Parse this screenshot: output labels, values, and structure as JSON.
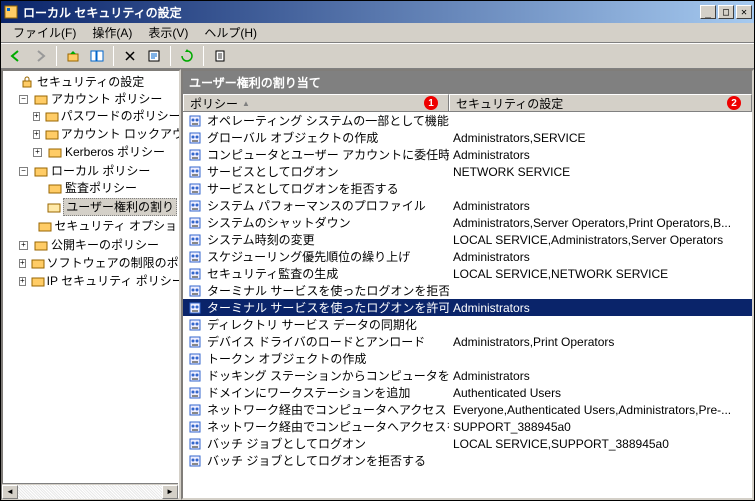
{
  "window": {
    "title": "ローカル セキュリティの設定"
  },
  "menu": {
    "file": "ファイル(F)",
    "action": "操作(A)",
    "view": "表示(V)",
    "help": "ヘルプ(H)"
  },
  "tree": {
    "root": "セキュリティの設定",
    "account": "アカウント ポリシー",
    "password": "パスワードのポリシー",
    "lockout": "アカウント ロックアウト",
    "kerberos": "Kerberos ポリシー",
    "local": "ローカル ポリシー",
    "audit": "監査ポリシー",
    "rights": "ユーザー権利の割り",
    "options": "セキュリティ オプショ",
    "publickey": "公開キーのポリシー",
    "software": "ソフトウェアの制限のポリシ",
    "ipsec": "IP セキュリティ ポリシー ("
  },
  "panel": {
    "title": "ユーザー権利の割り当て",
    "col1": "ポリシー",
    "col2": "セキュリティの設定",
    "badge1": "1",
    "badge2": "2"
  },
  "rows": [
    {
      "policy": "オペレーティング システムの一部として機能",
      "value": ""
    },
    {
      "policy": "グローバル オブジェクトの作成",
      "value": "Administrators,SERVICE"
    },
    {
      "policy": "コンピュータとユーザー アカウントに委任時の信頼を...",
      "value": "Administrators"
    },
    {
      "policy": "サービスとしてログオン",
      "value": "NETWORK SERVICE"
    },
    {
      "policy": "サービスとしてログオンを拒否する",
      "value": ""
    },
    {
      "policy": "システム パフォーマンスのプロファイル",
      "value": "Administrators"
    },
    {
      "policy": "システムのシャットダウン",
      "value": "Administrators,Server Operators,Print Operators,B..."
    },
    {
      "policy": "システム時刻の変更",
      "value": "LOCAL SERVICE,Administrators,Server Operators"
    },
    {
      "policy": "スケジューリング優先順位の繰り上げ",
      "value": "Administrators"
    },
    {
      "policy": "セキュリティ監査の生成",
      "value": "LOCAL SERVICE,NETWORK SERVICE"
    },
    {
      "policy": "ターミナル サービスを使ったログオンを拒否する",
      "value": ""
    },
    {
      "policy": "ターミナル サービスを使ったログオンを許可する",
      "value": "Administrators",
      "selected": true
    },
    {
      "policy": "ディレクトリ サービス データの同期化",
      "value": ""
    },
    {
      "policy": "デバイス ドライバのロードとアンロード",
      "value": "Administrators,Print Operators"
    },
    {
      "policy": "トークン オブジェクトの作成",
      "value": ""
    },
    {
      "policy": "ドッキング ステーションからコンピュータを削除",
      "value": "Administrators"
    },
    {
      "policy": "ドメインにワークステーションを追加",
      "value": "Authenticated Users"
    },
    {
      "policy": "ネットワーク経由でコンピュータへアクセス",
      "value": "Everyone,Authenticated Users,Administrators,Pre-..."
    },
    {
      "policy": "ネットワーク経由でコンピュータへアクセスを拒否する",
      "value": "SUPPORT_388945a0"
    },
    {
      "policy": "バッチ ジョブとしてログオン",
      "value": "LOCAL SERVICE,SUPPORT_388945a0"
    },
    {
      "policy": "バッチ ジョブとしてログオンを拒否する",
      "value": ""
    }
  ]
}
